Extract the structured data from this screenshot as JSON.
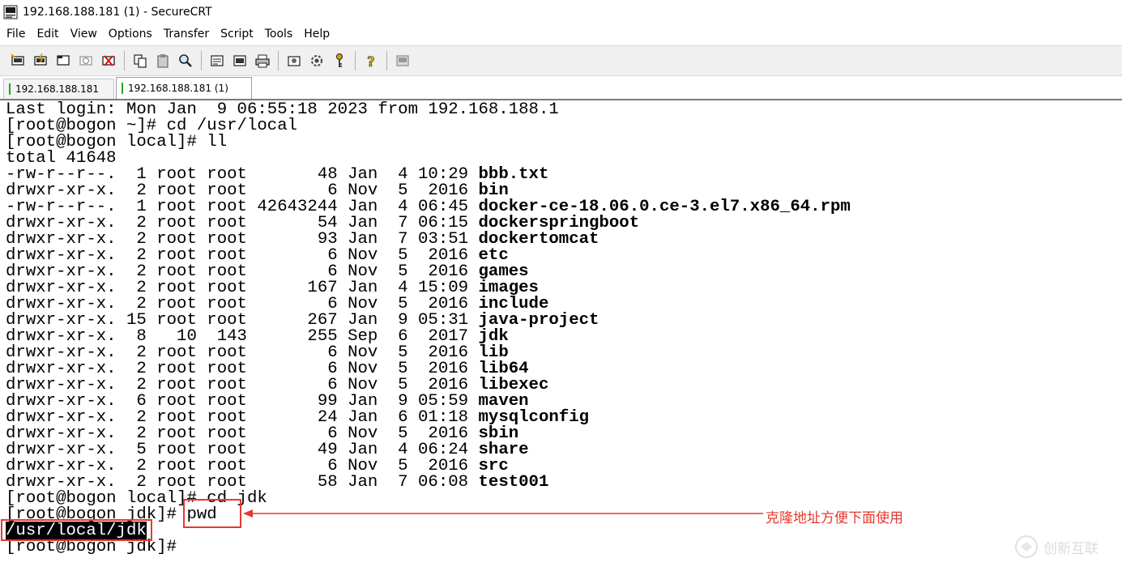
{
  "window": {
    "title": "192.168.188.181 (1) - SecureCRT"
  },
  "menu": {
    "items": [
      "File",
      "Edit",
      "View",
      "Options",
      "Transfer",
      "Script",
      "Tools",
      "Help"
    ]
  },
  "toolbar": {
    "icons": [
      "connect-icon",
      "quick-connect-icon",
      "connect-tab-icon",
      "reconnect-icon",
      "disconnect-icon",
      "copy-icon",
      "paste-icon",
      "find-icon",
      "print-setup-icon",
      "print-selection-icon",
      "print-icon",
      "session-options-icon",
      "global-options-icon",
      "keymap-icon",
      "help-icon",
      "sftp-icon"
    ]
  },
  "tabs": [
    {
      "label": "192.168.188.181",
      "active": false
    },
    {
      "label": "192.168.188.181  (1)",
      "active": true
    }
  ],
  "terminal": {
    "lines": [
      {
        "text": "Last login: Mon Jan  9 06:55:18 2023 from 192.168.188.1"
      },
      {
        "text": "[root@bogon ~]# cd /usr/local"
      },
      {
        "text": "[root@bogon local]# ll"
      },
      {
        "text": "total 41648"
      },
      {
        "text": "-rw-r--r--.  1 root root       48 Jan  4 10:29 ",
        "file": "bbb.txt"
      },
      {
        "text": "drwxr-xr-x.  2 root root        6 Nov  5  2016 ",
        "file": "bin"
      },
      {
        "text": "-rw-r--r--.  1 root root 42643244 Jan  4 06:45 ",
        "file": "docker-ce-18.06.0.ce-3.el7.x86_64.rpm"
      },
      {
        "text": "drwxr-xr-x.  2 root root       54 Jan  7 06:15 ",
        "file": "dockerspringboot"
      },
      {
        "text": "drwxr-xr-x.  2 root root       93 Jan  7 03:51 ",
        "file": "dockertomcat"
      },
      {
        "text": "drwxr-xr-x.  2 root root        6 Nov  5  2016 ",
        "file": "etc"
      },
      {
        "text": "drwxr-xr-x.  2 root root        6 Nov  5  2016 ",
        "file": "games"
      },
      {
        "text": "drwxr-xr-x.  2 root root      167 Jan  4 15:09 ",
        "file": "images"
      },
      {
        "text": "drwxr-xr-x.  2 root root        6 Nov  5  2016 ",
        "file": "include"
      },
      {
        "text": "drwxr-xr-x. 15 root root      267 Jan  9 05:31 ",
        "file": "java-project"
      },
      {
        "text": "drwxr-xr-x.  8   10  143      255 Sep  6  2017 ",
        "file": "jdk"
      },
      {
        "text": "drwxr-xr-x.  2 root root        6 Nov  5  2016 ",
        "file": "lib"
      },
      {
        "text": "drwxr-xr-x.  2 root root        6 Nov  5  2016 ",
        "file": "lib64"
      },
      {
        "text": "drwxr-xr-x.  2 root root        6 Nov  5  2016 ",
        "file": "libexec"
      },
      {
        "text": "drwxr-xr-x.  6 root root       99 Jan  9 05:59 ",
        "file": "maven"
      },
      {
        "text": "drwxr-xr-x.  2 root root       24 Jan  6 01:18 ",
        "file": "mysqlconfig"
      },
      {
        "text": "drwxr-xr-x.  2 root root        6 Nov  5  2016 ",
        "file": "sbin"
      },
      {
        "text": "drwxr-xr-x.  5 root root       49 Jan  4 06:24 ",
        "file": "share"
      },
      {
        "text": "drwxr-xr-x.  2 root root        6 Nov  5  2016 ",
        "file": "src"
      },
      {
        "text": "drwxr-xr-x.  2 root root       58 Jan  7 06:08 ",
        "file": "test001"
      },
      {
        "text": "[root@bogon local]# cd jdk"
      },
      {
        "text": "[root@bogon jdk]# ",
        "highlight_cmd": "pwd"
      },
      {
        "text": "",
        "selected": "/usr/local/jdk"
      },
      {
        "text": "[root@bogon jdk]#"
      }
    ]
  },
  "annotation": {
    "text": "克隆地址方便下面使用",
    "color": "#e53a30"
  },
  "watermark": {
    "text": "创新互联"
  }
}
